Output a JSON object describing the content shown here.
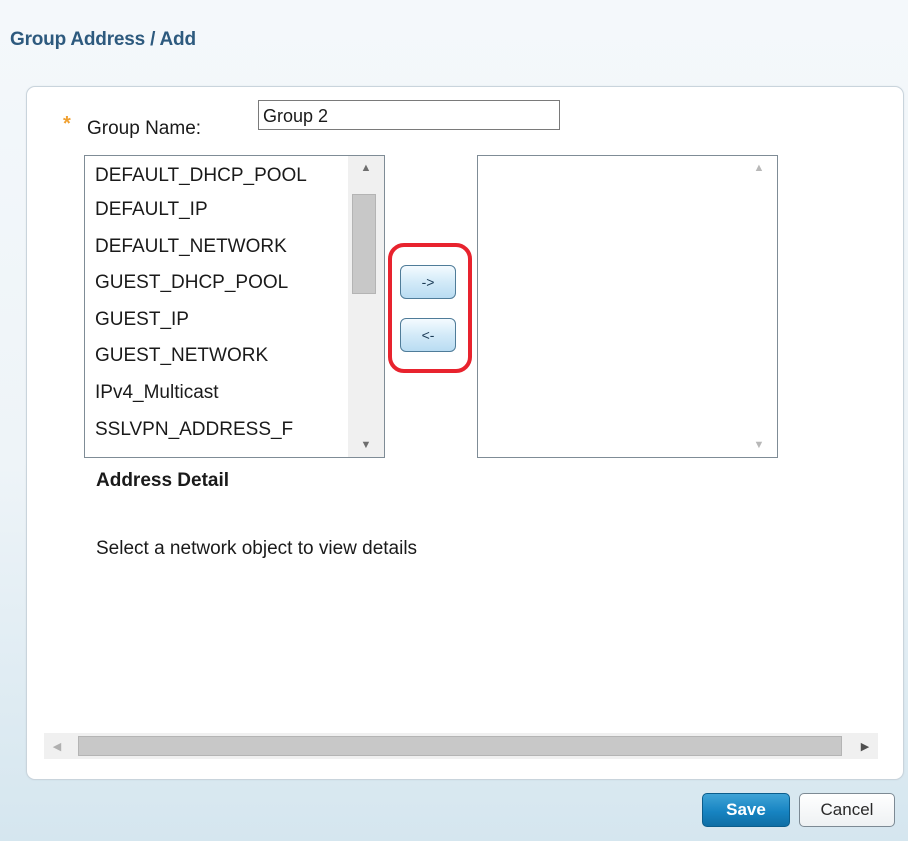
{
  "page": {
    "title": "Group Address / Add"
  },
  "form": {
    "required_marker": "*",
    "group_name_label": "Group Name:",
    "group_name_value": "Group 2"
  },
  "available_list": {
    "items": [
      "DEFAULT_DHCP_POOL",
      "DEFAULT_IP",
      "DEFAULT_NETWORK",
      "GUEST_DHCP_POOL",
      "GUEST_IP",
      "GUEST_NETWORK",
      "IPv4_Multicast",
      "SSLVPN_ADDRESS_F"
    ]
  },
  "selected_list": {
    "items": []
  },
  "transfer": {
    "add_label": "->",
    "remove_label": "<-"
  },
  "detail": {
    "heading": "Address Detail",
    "placeholder": "Select a network object to view details"
  },
  "footer": {
    "save_label": "Save",
    "cancel_label": "Cancel"
  },
  "icons": {
    "scroll_up": "triangle-up-icon",
    "scroll_down": "triangle-down-icon",
    "scroll_left": "triangle-left-icon",
    "scroll_right": "triangle-right-icon"
  },
  "colors": {
    "title": "#2d5a7e",
    "required": "#f0a030",
    "highlight": "#e8232e",
    "save_button": "#1784c2"
  }
}
